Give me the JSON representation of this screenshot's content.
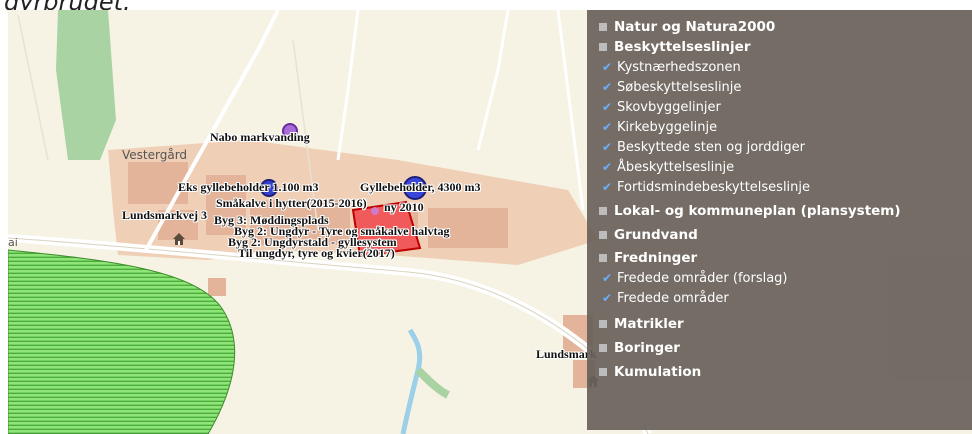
{
  "caption": "dyrbruget.",
  "map": {
    "place_labels": {
      "vestergaard": "Vestergård",
      "road": "ai"
    },
    "labels": {
      "nabo_markvanding": "Nabo markvanding",
      "eks_gyllebeholder": "Eks gyllebeholder 1.100 m3",
      "gyllebeholder_4300": "Gyllebeholder, 4300 m3",
      "smaakalve_hytter": "Småkalve i hytter(2015-2016)",
      "ny_2010": "ny 2010",
      "lundsmarkvej": "Lundsmarkvej 3",
      "byg3_moddingsplads": "Byg 3: Møddingsplads",
      "byg2_ungdyr_smaakalve": "Byg 2: Ungdyr - Tyre og småkalve halvtag",
      "byg2_ungdyrstald": "Byg 2: Ungdyrstald - gyllesystem",
      "kvier_2017": "Til ungdyr, tyre og kvier(2017)",
      "lundsmark": "Lundsmark"
    }
  },
  "layers_panel": {
    "groups": [
      {
        "label": "Natur og Natura2000"
      },
      {
        "label": "Beskyttelseslinjer",
        "items": [
          "Kystnærhedszonen",
          "Søbeskyttelseslinje",
          "Skovbyggelinjer",
          "Kirkebyggelinje",
          "Beskyttede sten og jorddiger",
          "Åbeskyttelseslinje",
          "Fortidsmindebeskyttelseslinje"
        ]
      },
      {
        "label": "Lokal- og kommuneplan (plansystem)"
      },
      {
        "label": "Grundvand"
      },
      {
        "label": "Fredninger",
        "items": [
          "Fredede områder (forslag)",
          "Fredede områder"
        ]
      },
      {
        "label": "Matrikler"
      },
      {
        "label": "Boringer"
      },
      {
        "label": "Kumulation"
      }
    ]
  },
  "colors": {
    "panel_bg": "#68615a",
    "check": "#6ab0ff",
    "field_green": "#7ee06a",
    "building": "#e8b79a",
    "selected_parcel": "#e0191a"
  }
}
